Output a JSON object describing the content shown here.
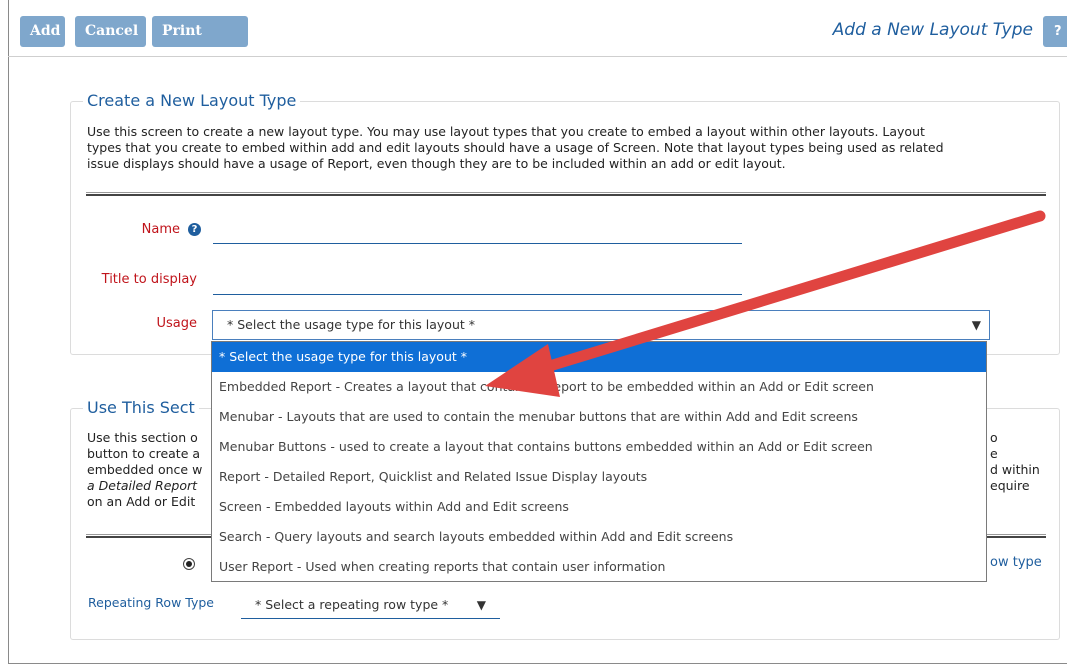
{
  "toolbar": {
    "add_label": "Add",
    "cancel_label": "Cancel",
    "print_label": "Print Page",
    "title": "Add a New Layout Type",
    "help_label": "?"
  },
  "section1": {
    "title": "Create a New Layout Type",
    "desc_line1": "Use this screen to create a new layout type. You may use layout types that you create to embed a layout within other layouts. Layout",
    "desc_line2": "types that you create to embed within add and edit layouts should have a usage of Screen. Note that layout types being used as related",
    "desc_line3": "issue displays should have a usage of Report, even though they are to be included within an add or edit layout.",
    "name_label": "Name",
    "name_value": "",
    "title_label": "Title to display",
    "title_value": "",
    "usage_label": "Usage",
    "usage_selected": "* Select the usage type for this layout *"
  },
  "usage_options": [
    "* Select the usage type for this layout *",
    "Embedded Report - Creates a layout that contains a report to be embedded within an Add or Edit screen",
    "Menubar - Layouts that are used to contain the menubar buttons that are within Add and Edit screens",
    "Menubar Buttons - used to create a layout that contains buttons embedded within an Add or Edit screen",
    "Report - Detailed Report, Quicklist and Related Issue Display layouts",
    "Screen - Embedded layouts within Add and Edit screens",
    "Search - Query layouts and search layouts embedded within Add and Edit screens",
    "User Report - Used when creating reports that contain user information"
  ],
  "section2": {
    "title": "Use This Sect",
    "left_line1": "Use this section o",
    "left_line2": "button to create a",
    "left_line3": "embedded once w",
    "left_line4": "a Detailed Report",
    "left_line5": "on an Add or Edit",
    "right_line1": "o",
    "right_line2": "e",
    "right_line3": "d within",
    "right_line4": "equire",
    "row_type_link": "ow type",
    "repeating_label": "Repeating Row Type",
    "repeating_selected": "* Select a repeating row type *"
  },
  "colors": {
    "accent": "#1f5e9e",
    "button": "#7fa7cc",
    "required": "#c0141b",
    "highlight": "#0f6fd6",
    "annotation_arrow": "#e04440"
  }
}
